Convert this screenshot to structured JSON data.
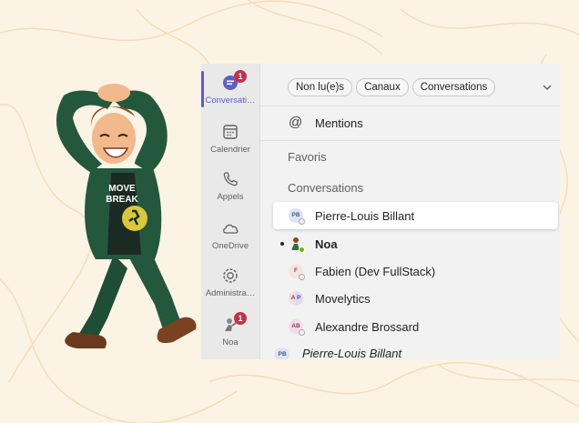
{
  "colors": {
    "accent": "#5b5fc7",
    "badge": "#c4314b",
    "background": "#fbf3e4"
  },
  "mascot": {
    "shirt_text_line1": "MOVE",
    "shirt_text_line2": "BREAK"
  },
  "rail": {
    "items": [
      {
        "label": "Conversati…",
        "icon": "chat-icon",
        "badge": "1"
      },
      {
        "label": "Calendrier",
        "icon": "calendar-icon"
      },
      {
        "label": "Appels",
        "icon": "phone-icon"
      },
      {
        "label": "OneDrive",
        "icon": "cloud-icon"
      },
      {
        "label": "Administra…",
        "icon": "admin-app-icon"
      },
      {
        "label": "Noa",
        "icon": "noa-app-icon",
        "badge": "1"
      }
    ]
  },
  "filters": [
    "Non lu(e)s",
    "Canaux",
    "Conversations"
  ],
  "mentions_label": "Mentions",
  "sections": {
    "favorites": "Favoris",
    "conversations": "Conversations"
  },
  "chats": [
    {
      "name": "Pierre-Louis Billant",
      "initials": "PB"
    },
    {
      "name": "Noa",
      "initials": ""
    },
    {
      "name": "Fabien (Dev FullStack)",
      "initials": "F"
    },
    {
      "name": "Movelytics",
      "initials": "A P"
    },
    {
      "name": "Alexandre Brossard",
      "initials": "AB"
    },
    {
      "name": "Pierre-Louis Billant",
      "initials": "PB"
    }
  ]
}
